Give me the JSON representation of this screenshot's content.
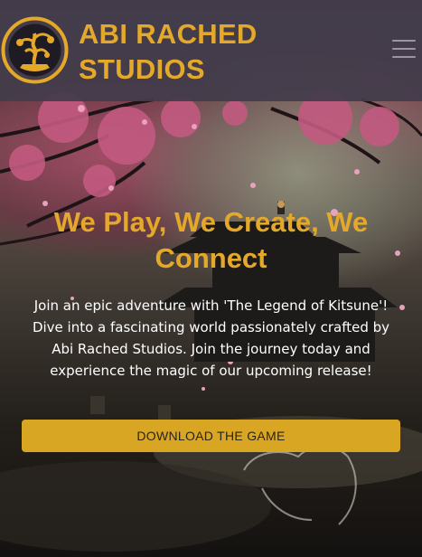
{
  "header": {
    "brand_line1": "ABI RACHED",
    "brand_line2": "STUDIOS",
    "logo_icon": "bonsai-tree-logo-icon",
    "menu_icon": "hamburger-menu-icon"
  },
  "hero": {
    "title": "We Play, We Create, We Connect",
    "text": "Join an epic adventure with 'The Legend of Kitsune'! Dive into a fascinating world passionately crafted by Abi Rached Studios. Join the journey today and experience the magic of our upcoming release!",
    "cta_label": "DOWNLOAD THE GAME"
  },
  "colors": {
    "accent": "#e4a82a",
    "button": "#d8a623",
    "header_bg": "#423c4b",
    "text": "#ffffff"
  }
}
